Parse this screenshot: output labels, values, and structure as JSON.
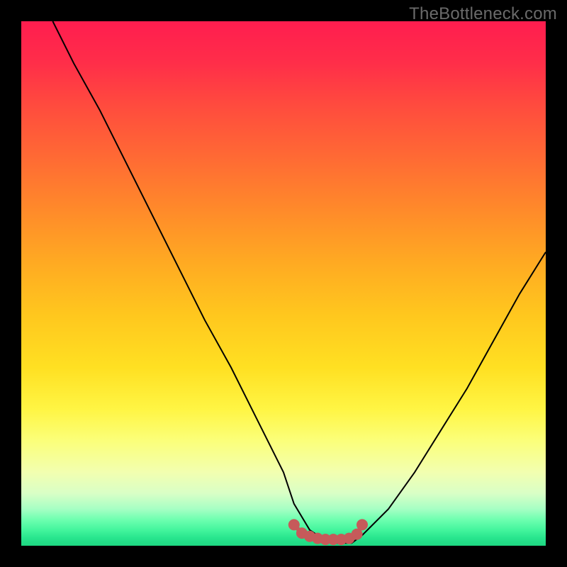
{
  "watermark": {
    "text": "TheBottleneck.com"
  },
  "chart_data": {
    "type": "line",
    "title": "",
    "xlabel": "",
    "ylabel": "",
    "xlim": [
      0,
      100
    ],
    "ylim": [
      0,
      100
    ],
    "grid": false,
    "legend": false,
    "series": [
      {
        "name": "bottleneck-curve",
        "x": [
          6,
          10,
          15,
          20,
          25,
          30,
          35,
          40,
          45,
          50,
          52,
          55,
          58,
          60,
          63,
          65,
          70,
          75,
          80,
          85,
          90,
          95,
          100
        ],
        "y": [
          100,
          92,
          83,
          73,
          63,
          53,
          43,
          34,
          24,
          14,
          8,
          3,
          1,
          0.5,
          0.5,
          2,
          7,
          14,
          22,
          30,
          39,
          48,
          56
        ],
        "color": "#000000"
      },
      {
        "name": "optimal-range-marker",
        "x": [
          52,
          53.5,
          55,
          56.5,
          58,
          59.5,
          61,
          62.5,
          64,
          65
        ],
        "y": [
          4,
          2.4,
          1.8,
          1.4,
          1.2,
          1.2,
          1.2,
          1.4,
          2.2,
          4
        ],
        "color": "#c65a5a"
      }
    ],
    "gradient_stops": [
      {
        "pos": 0,
        "color": "#ff1d4f"
      },
      {
        "pos": 0.3,
        "color": "#ff7a2e"
      },
      {
        "pos": 0.6,
        "color": "#ffd722"
      },
      {
        "pos": 0.8,
        "color": "#fbff7a"
      },
      {
        "pos": 0.93,
        "color": "#a6ffc4"
      },
      {
        "pos": 1.0,
        "color": "#1ed781"
      }
    ]
  }
}
